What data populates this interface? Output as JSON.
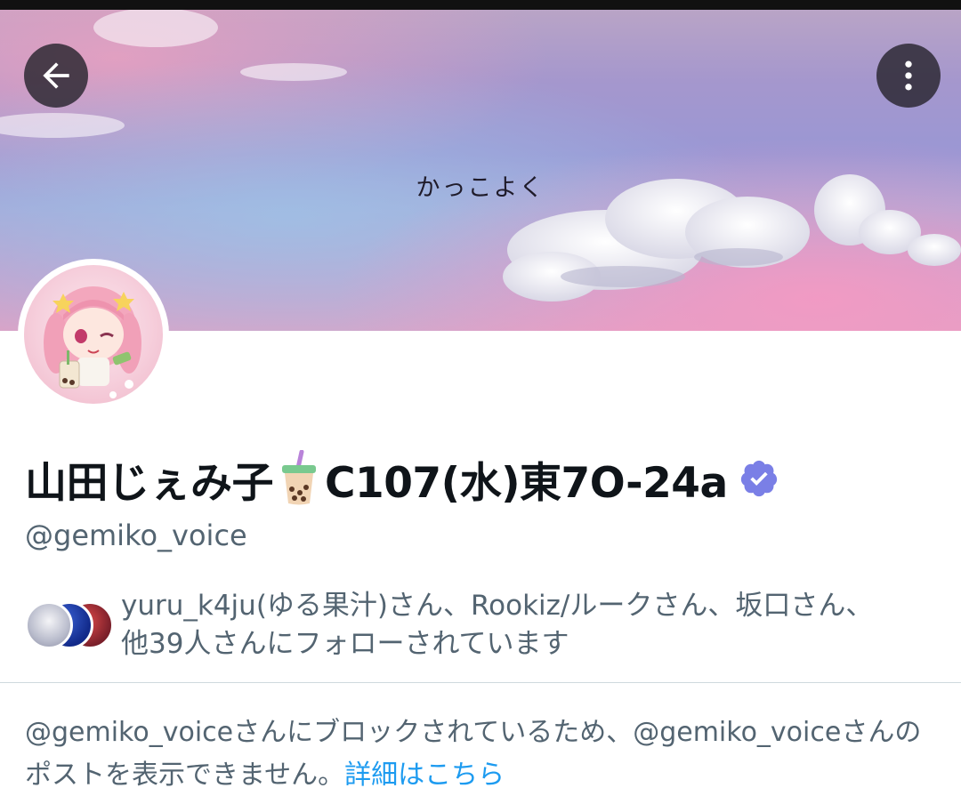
{
  "banner": {
    "caption": "かっこよく"
  },
  "profile": {
    "display_name": "山田じぇみ子",
    "display_name_suffix": "C107(水)東7O-24a",
    "handle": "@gemiko_voice"
  },
  "followed_by": {
    "text_line1": "yuru_k4ju(ゆる果汁)さん、Rookiz/ルークさん、坂口さん、",
    "text_line2": "他39人さんにフォローされています"
  },
  "blocked_notice": {
    "text_line1": "@gemiko_voiceさんにブロックされているため、@gemiko_voiceさんの",
    "text_line2": "ポストを表示できません。",
    "link_label": "詳細はこちら"
  },
  "icons": {
    "back": "arrow-left-icon",
    "more": "more-vertical-icon",
    "name_emoji": "bubble-tea-icon",
    "verified": "verified-badge-icon"
  },
  "colors": {
    "link": "#1d9bf0",
    "secondary_text": "#536471",
    "verified_badge": "#7a7fe6",
    "primary_text": "#0f1419"
  }
}
